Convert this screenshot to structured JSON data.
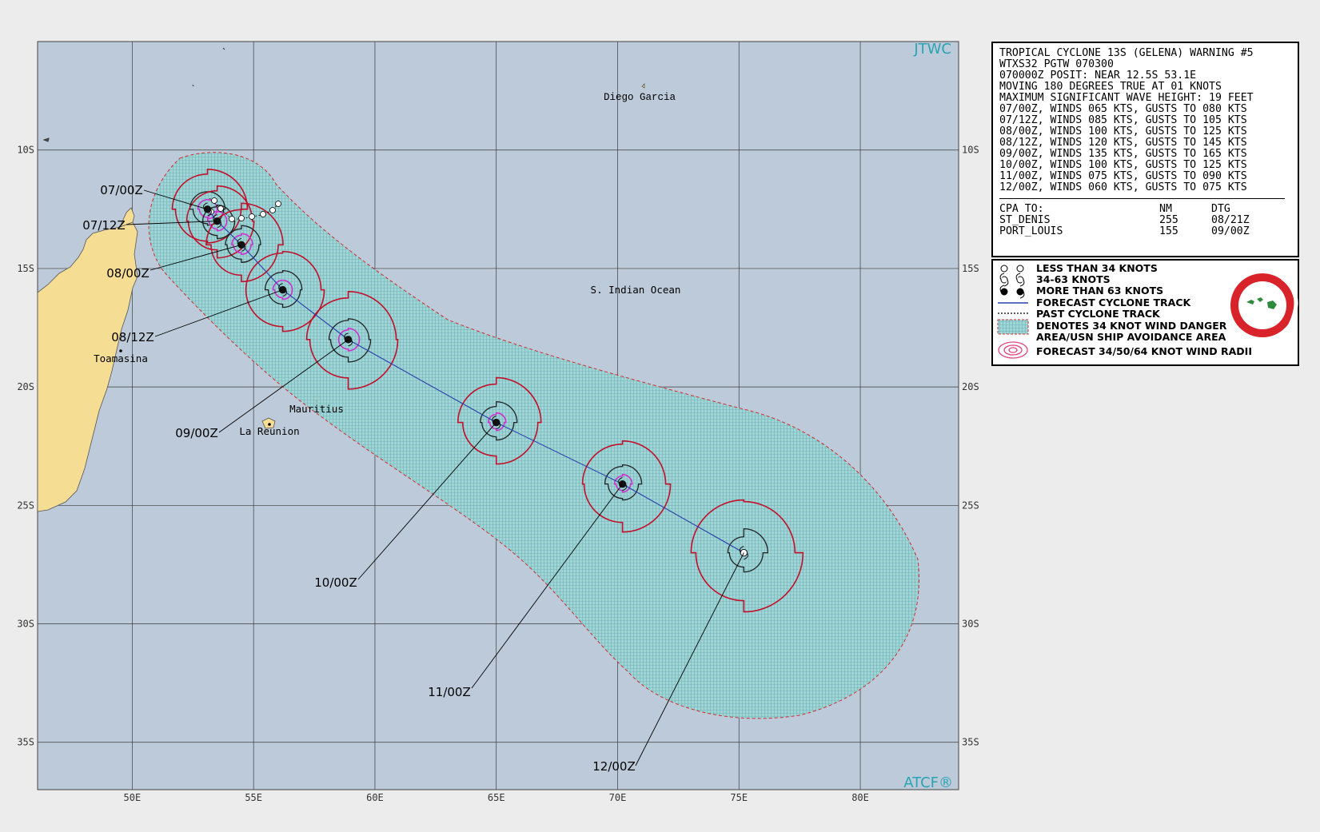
{
  "map": {
    "agency_top": "JTWC",
    "agency_bottom": "ATCF®",
    "lon_ticks": [
      "50E",
      "55E",
      "60E",
      "65E",
      "70E",
      "75E",
      "80E"
    ],
    "lat_ticks": [
      "10S",
      "15S",
      "20S",
      "25S",
      "30S",
      "35S"
    ],
    "place_labels": [
      "Diego Garcia",
      "S. Indian Ocean",
      "Mauritius",
      "La Reunion",
      "Toamasina"
    ],
    "colors": {
      "ocean": "#bccad9",
      "land": "#f6dd94",
      "danger_area": "#93cfd1",
      "track": "#2a3ea8",
      "radius34": "#c0102a",
      "radius50": "#222222",
      "radius64": "#cc33cc",
      "border": "#1f6fbf"
    }
  },
  "forecast_points": [
    {
      "label": "07/00Z",
      "lat": -12.5,
      "lon": 53.1
    },
    {
      "label": "07/12Z",
      "lat": -13.0,
      "lon": 53.5
    },
    {
      "label": "08/00Z",
      "lat": -14.0,
      "lon": 54.5
    },
    {
      "label": "08/12Z",
      "lat": -15.9,
      "lon": 56.2
    },
    {
      "label": "09/00Z",
      "lat": -18.0,
      "lon": 58.9
    },
    {
      "label": "10/00Z",
      "lat": -21.5,
      "lon": 65.0
    },
    {
      "label": "11/00Z",
      "lat": -24.1,
      "lon": 70.2
    },
    {
      "label": "12/00Z",
      "lat": -27.0,
      "lon": 75.2
    }
  ],
  "warning": {
    "lines": [
      "TROPICAL CYCLONE 13S (GELENA) WARNING #5",
      "WTXS32 PGTW 070300",
      "070000Z POSIT: NEAR 12.5S 53.1E",
      "MOVING 180 DEGREES TRUE AT 01 KNOTS",
      "MAXIMUM SIGNIFICANT WAVE HEIGHT: 19 FEET",
      "07/00Z, WINDS 065 KTS, GUSTS TO 080 KTS",
      "07/12Z, WINDS 085 KTS, GUSTS TO 105 KTS",
      "08/00Z, WINDS 100 KTS, GUSTS TO 125 KTS",
      "08/12Z, WINDS 120 KTS, GUSTS TO 145 KTS",
      "09/00Z, WINDS 135 KTS, GUSTS TO 165 KTS",
      "10/00Z, WINDS 100 KTS, GUSTS TO 125 KTS",
      "11/00Z, WINDS 075 KTS, GUSTS TO 090 KTS",
      "12/00Z, WINDS 060 KTS, GUSTS TO 075 KTS"
    ],
    "cpa_header": [
      "CPA TO:",
      "NM",
      "DTG"
    ],
    "cpa_rows": [
      [
        "ST_DENIS",
        "255",
        "08/21Z"
      ],
      [
        "PORT_LOUIS",
        "155",
        "09/00Z"
      ]
    ]
  },
  "legend": [
    "LESS THAN 34 KNOTS",
    "34-63 KNOTS",
    "MORE THAN 63 KNOTS",
    "FORECAST CYCLONE TRACK",
    "PAST CYCLONE TRACK",
    "DENOTES 34 KNOT WIND DANGER",
    "AREA/USN SHIP AVOIDANCE AREA",
    "FORECAST 34/50/64 KNOT WIND RADII"
  ]
}
